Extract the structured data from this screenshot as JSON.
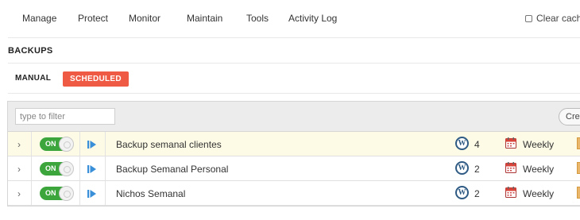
{
  "nav": {
    "items": [
      "Manage",
      "Protect",
      "Monitor",
      "Maintain",
      "Tools",
      "Activity Log"
    ],
    "clear_cache_label": "Clear cache"
  },
  "section": {
    "title": "BACKUPS"
  },
  "tabs": {
    "manual": "MANUAL",
    "scheduled": "SCHEDULED",
    "active": "scheduled"
  },
  "toolbar": {
    "filter_placeholder": "type to filter",
    "filter_value": "",
    "create_label": "Create"
  },
  "rows": [
    {
      "toggle": "ON",
      "name": "Backup semanal clientes",
      "wp_count": "4",
      "frequency": "Weekly",
      "highlighted": true
    },
    {
      "toggle": "ON",
      "name": "Backup Semanal Personal",
      "wp_count": "2",
      "frequency": "Weekly",
      "highlighted": false
    },
    {
      "toggle": "ON",
      "name": "Nichos Semanal",
      "wp_count": "2",
      "frequency": "Weekly",
      "highlighted": false
    }
  ],
  "icons": {
    "chevron": "chevron-right-icon",
    "toggle": "toggle-switch-icon",
    "play": "play-icon",
    "wordpress": "wordpress-icon",
    "calendar": "calendar-icon"
  },
  "colors": {
    "accent_scheduled": "#ee5a43",
    "toggle_on": "#3ca53c",
    "row_highlight": "#fdfbe6",
    "play_blue": "#3a8fd9",
    "wordpress_blue": "#2f5b84"
  }
}
